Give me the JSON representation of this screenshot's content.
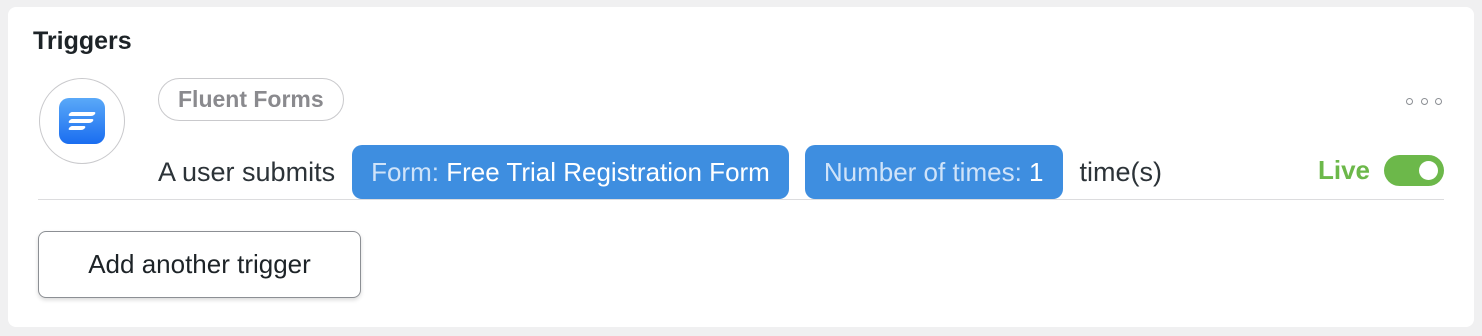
{
  "panel": {
    "title": "Triggers"
  },
  "trigger": {
    "app_name": "Fluent Forms",
    "app_icon": "fluent-forms-logo",
    "sentence_prefix": "A user submits",
    "form_token": {
      "key": "Form:",
      "value": "Free Trial Registration Form"
    },
    "times_token": {
      "key": "Number of times:",
      "value": "1"
    },
    "sentence_suffix": "time(s)",
    "status_label": "Live",
    "status_enabled": true,
    "more_icon": "ellipsis-icon"
  },
  "actions": {
    "add_trigger_label": "Add another trigger"
  },
  "colors": {
    "token_bg": "#3e8ee0",
    "live_green": "#6cb84a",
    "logo_blue": "#1a6df0"
  }
}
